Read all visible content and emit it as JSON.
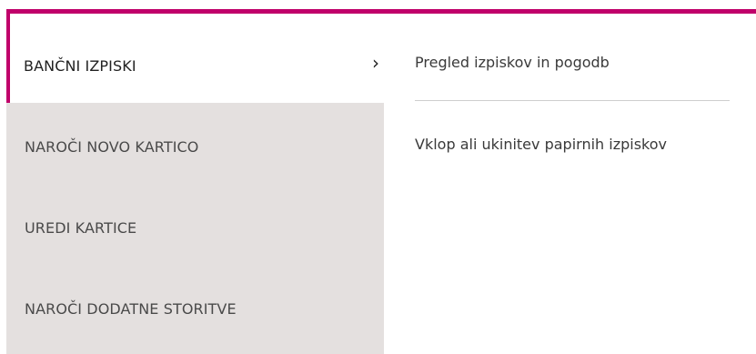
{
  "accent_color": "#c0006a",
  "left_menu": {
    "active_item": {
      "label": "BANČNI IZPISKI",
      "chevron": "›"
    },
    "items": [
      {
        "label": "NAROČI NOVO KARTICO"
      },
      {
        "label": "UREDI KARTICE"
      },
      {
        "label": "NAROČI DODATNE STORITVE"
      }
    ]
  },
  "submenu": {
    "links": [
      {
        "label": "Pregled izpiskov in pogodb"
      },
      {
        "label": "Vklop ali ukinitev papirnih izpiskov"
      }
    ]
  }
}
